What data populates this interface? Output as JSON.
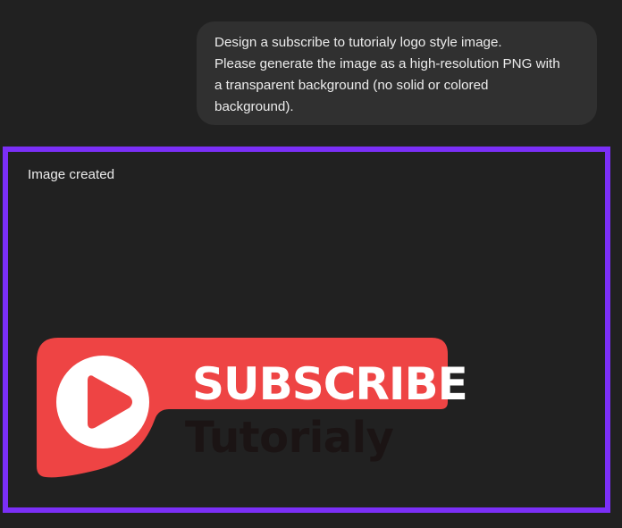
{
  "chat": {
    "user_message_lines": [
      "Design a subscribe to tutorialy logo style image.",
      "Please generate the image as a high-resolution PNG with",
      "a transparent background (no solid or colored",
      "background)."
    ]
  },
  "result": {
    "status": "Image created",
    "image": {
      "headline": "SUBSCRIBE",
      "brand": "Tutorialy",
      "icon": "play-icon"
    }
  },
  "colors": {
    "background": "#212121",
    "bubble": "#303030",
    "highlight_border": "#7b2ff7",
    "logo_red": "#ee4444",
    "brand_dark": "#1b1414"
  }
}
